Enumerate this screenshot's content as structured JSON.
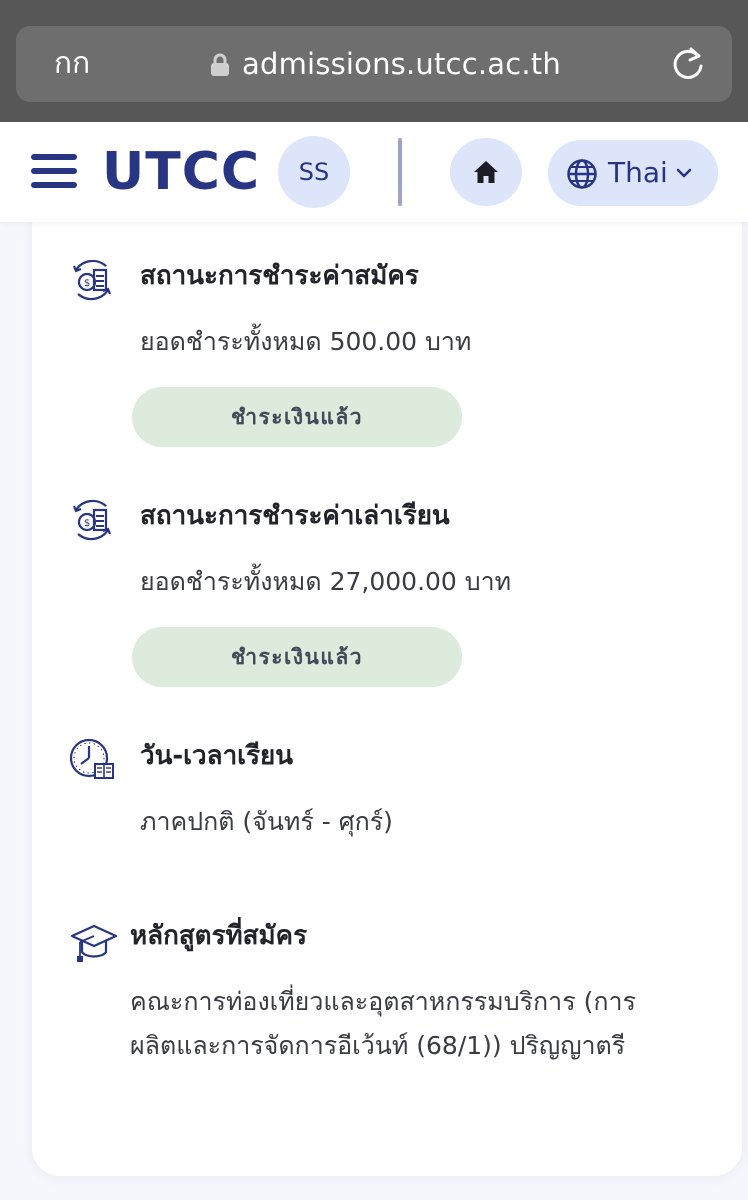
{
  "browser": {
    "aa_label": "กก",
    "url": "admissions.utcc.ac.th"
  },
  "header": {
    "logo": "UTCC",
    "avatar_initials": "SS",
    "language": "Thai"
  },
  "sections": {
    "application_fee": {
      "title": "สถานะการชำระค่าสมัคร",
      "amount_text": "ยอดชำระทั้งหมด 500.00 บาท",
      "status": "ชำระเงินแล้ว"
    },
    "tuition_fee": {
      "title": "สถานะการชำระค่าเล่าเรียน",
      "amount_text": "ยอดชำระทั้งหมด 27,000.00 บาท",
      "status": "ชำระเงินแล้ว"
    },
    "schedule": {
      "title": "วัน-เวลาเรียน",
      "value": "ภาคปกติ (จันทร์ - ศุกร์)"
    },
    "course": {
      "title": "หลักสูตรที่สมัคร",
      "line1": "คณะการท่องเที่ยวและอุตสาหกรรมบริการ (การ",
      "line2": "ผลิตและการจัดการอีเว้นท์ (68/1)) ปริญญาตรี"
    }
  },
  "colors": {
    "brand": "#283583",
    "pill_bg": "#dcebdc",
    "button_bg": "#dde5fb"
  },
  "icons": [
    "lock-icon",
    "reload-icon",
    "menu-icon",
    "home-icon",
    "globe-icon",
    "chevron-down-icon",
    "payment-icon",
    "clock-book-icon",
    "graduation-cap-icon"
  ]
}
